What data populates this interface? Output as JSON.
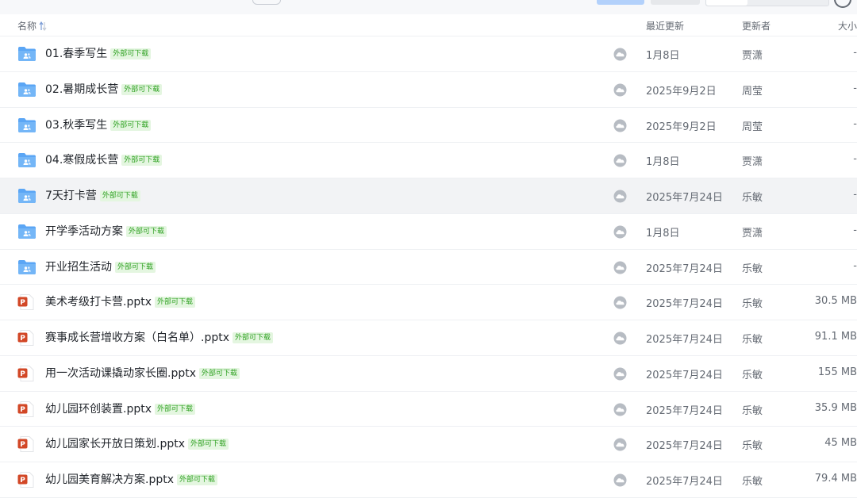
{
  "header": {
    "name": "名称",
    "updated": "最近更新",
    "updater": "更新者",
    "size": "大小"
  },
  "colors": {
    "folder": "#5ba6f5",
    "ppt": "#d24726",
    "tag_text": "#2ea121",
    "tag_bg": "#e4f6e0"
  },
  "rows": [
    {
      "icon": "folder-shared-icon",
      "name": "01.春季写生",
      "tag": "外部可下载",
      "date": "1月8日",
      "updater": "贾潇",
      "size": "-"
    },
    {
      "icon": "folder-shared-icon",
      "name": "02.暑期成长营",
      "tag": "外部可下载",
      "date": "2025年9月2日",
      "updater": "周莹",
      "size": "-"
    },
    {
      "icon": "folder-shared-icon",
      "name": "03.秋季写生",
      "tag": "外部可下载",
      "date": "2025年9月2日",
      "updater": "周莹",
      "size": "-"
    },
    {
      "icon": "folder-shared-icon",
      "name": "04.寒假成长营",
      "tag": "外部可下载",
      "date": "1月8日",
      "updater": "贾潇",
      "size": "-"
    },
    {
      "icon": "folder-shared-icon",
      "name": "7天打卡营",
      "tag": "外部可下载",
      "date": "2025年7月24日",
      "updater": "乐敏",
      "size": "-"
    },
    {
      "icon": "folder-shared-icon",
      "name": "开学季活动方案",
      "tag": "外部可下载",
      "date": "1月8日",
      "updater": "贾潇",
      "size": "-"
    },
    {
      "icon": "folder-shared-icon",
      "name": "开业招生活动",
      "tag": "外部可下载",
      "date": "2025年7月24日",
      "updater": "乐敏",
      "size": "-"
    },
    {
      "icon": "pptx-file-icon",
      "name": "美术考级打卡营.pptx",
      "tag": "外部可下载",
      "date": "2025年7月24日",
      "updater": "乐敏",
      "size": "30.5 MB"
    },
    {
      "icon": "pptx-file-icon",
      "name": "赛事成长营增收方案（白名单）.pptx",
      "tag": "外部可下载",
      "date": "2025年7月24日",
      "updater": "乐敏",
      "size": "91.1 MB"
    },
    {
      "icon": "pptx-file-icon",
      "name": "用一次活动课撬动家长圈.pptx",
      "tag": "外部可下载",
      "date": "2025年7月24日",
      "updater": "乐敏",
      "size": "155 MB"
    },
    {
      "icon": "pptx-file-icon",
      "name": "幼儿园环创装置.pptx",
      "tag": "外部可下载",
      "date": "2025年7月24日",
      "updater": "乐敏",
      "size": "35.9 MB"
    },
    {
      "icon": "pptx-file-icon",
      "name": "幼儿园家长开放日策划.pptx",
      "tag": "外部可下载",
      "date": "2025年7月24日",
      "updater": "乐敏",
      "size": "45 MB"
    },
    {
      "icon": "pptx-file-icon",
      "name": "幼儿园美育解决方案.pptx",
      "tag": "外部可下载",
      "date": "2025年7月24日",
      "updater": "乐敏",
      "size": "79.4 MB"
    }
  ]
}
